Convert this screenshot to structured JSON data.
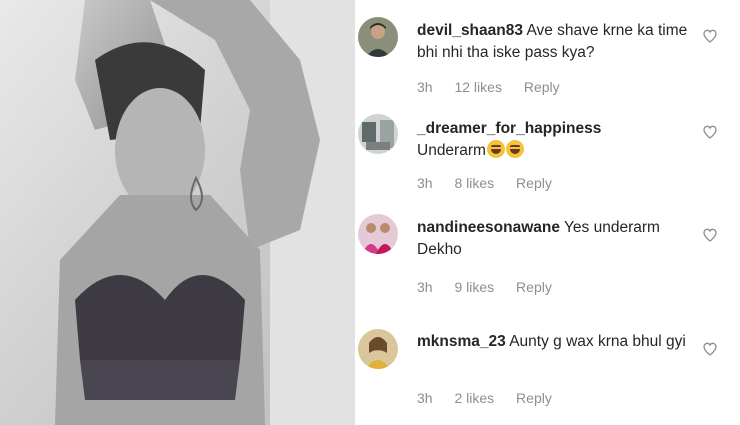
{
  "comments": [
    {
      "username": "devil_shaan83",
      "text": "Ave shave krne ka time bhi nhi tha iske pass kya?",
      "time": "3h",
      "likes": "12 likes",
      "reply": "Reply",
      "avatar_icon": "user-avatar-man-icon"
    },
    {
      "username": "_dreamer_for_happiness",
      "text": "Underarm",
      "emoji": "😂😂",
      "time": "3h",
      "likes": "8 likes",
      "reply": "Reply",
      "avatar_icon": "user-avatar-room-icon"
    },
    {
      "username": "nandineesonawane",
      "text": "Yes underarm Dekho",
      "time": "3h",
      "likes": "9 likes",
      "reply": "Reply",
      "avatar_icon": "user-avatar-two-people-icon"
    },
    {
      "username": "mknsma_23",
      "text": "Aunty g wax krna bhul gyi",
      "time": "3h",
      "likes": "2 likes",
      "reply": "Reply",
      "avatar_icon": "user-avatar-woman-icon"
    }
  ],
  "colors": {
    "text": "#262626",
    "muted": "#8e8e8e",
    "heart_stroke": "#8e8e8e"
  }
}
